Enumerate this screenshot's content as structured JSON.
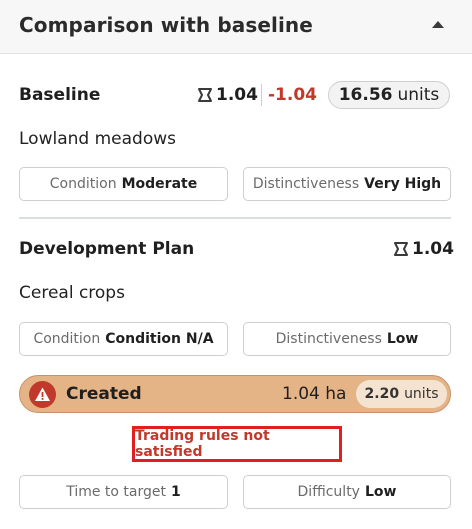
{
  "header": {
    "title": "Comparison with baseline"
  },
  "baseline": {
    "title": "Baseline",
    "area": "1.04",
    "change": "-1.04",
    "units_value": "16.56",
    "units_label": "units",
    "habitat": "Lowland meadows",
    "condition_label": "Condition",
    "condition_value": "Moderate",
    "distinctiveness_label": "Distinctiveness",
    "distinctiveness_value": "Very High"
  },
  "plan": {
    "title": "Development Plan",
    "area": "1.04",
    "habitat": "Cereal crops",
    "condition_label": "Condition",
    "condition_value": "Condition N/A",
    "distinctiveness_label": "Distinctiveness",
    "distinctiveness_value": "Low"
  },
  "created": {
    "label": "Created",
    "hectares": "1.04 ha",
    "units_value": "2.20",
    "units_label": "units"
  },
  "error": {
    "message": "Trading rules not satisfied"
  },
  "footer": {
    "time_label": "Time to target",
    "time_value": "1",
    "difficulty_label": "Difficulty",
    "difficulty_value": "Low"
  },
  "colors": {
    "negative": "#c0392b",
    "created_bg": "#e4b487",
    "error_border": "#e02020"
  }
}
